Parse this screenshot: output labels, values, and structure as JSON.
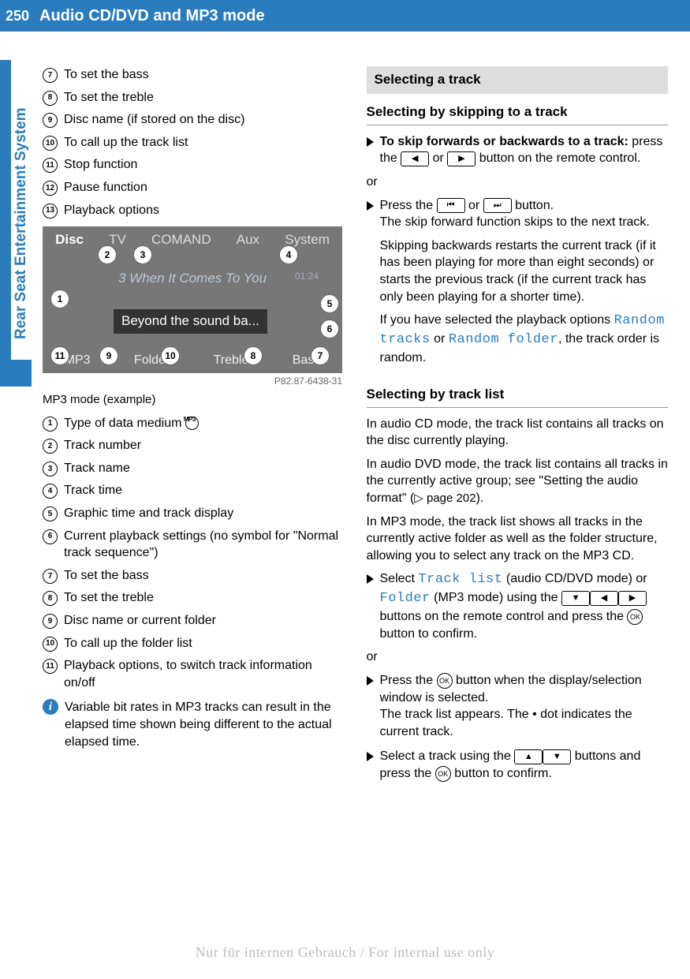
{
  "page_number": "250",
  "header_title": "Audio CD/DVD and MP3 mode",
  "side_tab": "Rear Seat Entertainment System",
  "col1_top_list": [
    {
      "n": "7",
      "t": "To set the bass"
    },
    {
      "n": "8",
      "t": "To set the treble"
    },
    {
      "n": "9",
      "t": "Disc name (if stored on the disc)"
    },
    {
      "n": "10",
      "t": "To call up the track list"
    },
    {
      "n": "11",
      "t": "Stop function"
    },
    {
      "n": "12",
      "t": "Pause function"
    },
    {
      "n": "13",
      "t": "Playback options"
    }
  ],
  "figure": {
    "menu": [
      "Disc",
      "TV",
      "COMAND",
      "Aux",
      "System"
    ],
    "title_line": "3 When It Comes To You",
    "time": "01:24",
    "beyond": "Beyond the sound ba...",
    "bottom": [
      "MP3",
      "Folder",
      "Treble",
      "Bass"
    ],
    "ref": "P82.87-6438-31",
    "callouts": {
      "1": {
        "l": 10,
        "t": 80
      },
      "2": {
        "l": 70,
        "t": 24
      },
      "3": {
        "l": 115,
        "t": 24
      },
      "4": {
        "l": 300,
        "t": 24
      },
      "5": {
        "l": 352,
        "t": 86
      },
      "6": {
        "l": 352,
        "t": 118
      },
      "7": {
        "l": 340,
        "t": 152
      },
      "8": {
        "l": 255,
        "t": 152
      },
      "9": {
        "l": 72,
        "t": 152
      },
      "10": {
        "l": 150,
        "t": 152
      },
      "11": {
        "l": 10,
        "t": 152
      }
    }
  },
  "caption": "MP3 mode (example)",
  "col1_bottom_list": [
    {
      "n": "1",
      "t": "Type of data medium",
      "mp3": true
    },
    {
      "n": "2",
      "t": "Track number"
    },
    {
      "n": "3",
      "t": "Track name"
    },
    {
      "n": "4",
      "t": "Track time"
    },
    {
      "n": "5",
      "t": "Graphic time and track display"
    },
    {
      "n": "6",
      "t": "Current playback settings (no symbol for \"Normal track sequence\")"
    },
    {
      "n": "7",
      "t": "To set the bass"
    },
    {
      "n": "8",
      "t": "To set the treble"
    },
    {
      "n": "9",
      "t": "Disc name or current folder"
    },
    {
      "n": "10",
      "t": "To call up the folder list"
    },
    {
      "n": "11",
      "t": "Playback options, to switch track information on/off"
    }
  ],
  "info_note": "Variable bit rates in MP3 tracks can result in the elapsed time shown being different to the actual elapsed time.",
  "section_bar": "Selecting a track",
  "sub1": "Selecting by skipping to a track",
  "step1_bold": "To skip forwards or backwards to a track:",
  "step1_rest_a": " press the ",
  "step1_rest_b": " or ",
  "step1_rest_c": " button on the remote control.",
  "or": "or",
  "step2_a": "Press the ",
  "step2_b": " or ",
  "step2_c": " button.",
  "step2_line2": "The skip forward function skips to the next track.",
  "step2_line3": "Skipping backwards restarts the current track (if it has been playing for more than eight seconds) or starts the previous track (if the current track has only been playing for a shorter time).",
  "step2_line4_a": "If you have selected the playback options ",
  "step2_line4_rt": "Random tracks",
  "step2_line4_b": " or ",
  "step2_line4_rf": "Random folder",
  "step2_line4_c": ", the track order is random.",
  "sub2": "Selecting by track list",
  "p1": "In audio CD mode, the track list contains all tracks on the disc currently playing.",
  "p2_a": "In audio DVD mode, the track list contains all tracks in the currently active group; see \"Setting the audio format\" (",
  "p2_ref": "▷ page 202",
  "p2_b": ").",
  "p3": "In MP3 mode, the track list shows all tracks in the currently active folder as well as the folder structure, allowing you to select any track on the MP3 CD.",
  "step3_a": "Select ",
  "step3_tl": "Track list",
  "step3_b": " (audio CD/DVD mode) or ",
  "step3_f": "Folder",
  "step3_c": " (MP3 mode) using the ",
  "step3_d": " buttons on the remote control and press the ",
  "step3_e": " button to confirm.",
  "step4_a": "Press the ",
  "step4_b": " button when the display/selection window is selected.",
  "step4_c": "The track list appears. The  •  dot indicates the current track.",
  "step5_a": "Select a track using the ",
  "step5_b": " buttons and press the ",
  "step5_c": " button to confirm.",
  "watermark": "Nur für internen Gebrauch / For internal use only",
  "icons": {
    "left": "◀",
    "right": "▶",
    "skipb": "⏮",
    "skipf": "⏭",
    "up": "▲",
    "down": "▼",
    "ok": "OK"
  }
}
